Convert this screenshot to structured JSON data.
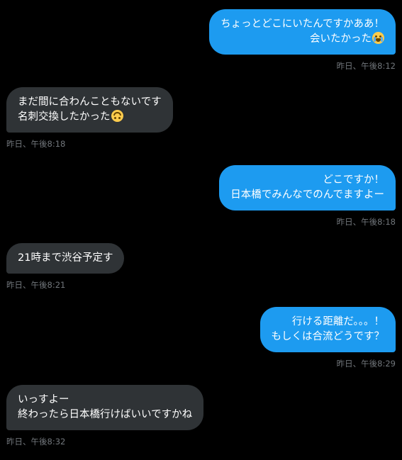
{
  "colors": {
    "background": "#000000",
    "outgoing_bubble": "#1d9bf0",
    "incoming_bubble": "#2f3336",
    "timestamp": "#71767b"
  },
  "messages": [
    {
      "direction": "outgoing",
      "lines": [
        "ちょっとどこにいたんですかああ！",
        "会いたかった"
      ],
      "emoji": "loudly-crying-face-icon",
      "time": "昨日、午後8:12"
    },
    {
      "direction": "incoming",
      "lines": [
        "まだ間に合わんこともないです",
        "名刺交換したかった"
      ],
      "emoji": "upside-down-face-icon",
      "time": "昨日、午後8:18"
    },
    {
      "direction": "outgoing",
      "lines": [
        "どこですか！",
        "日本橋でみんなでのんでますよー"
      ],
      "time": "昨日、午後8:18"
    },
    {
      "direction": "incoming",
      "lines": [
        "21時まで渋谷予定す"
      ],
      "time": "昨日、午後8:21"
    },
    {
      "direction": "outgoing",
      "lines": [
        "行ける距離だ。。。！",
        "もしくは合流どうです？"
      ],
      "time": "昨日、午後8:29"
    },
    {
      "direction": "incoming",
      "lines": [
        "いっすよー",
        "終わったら日本橋行けばいいですかね"
      ],
      "time": "昨日、午後8:32"
    }
  ]
}
